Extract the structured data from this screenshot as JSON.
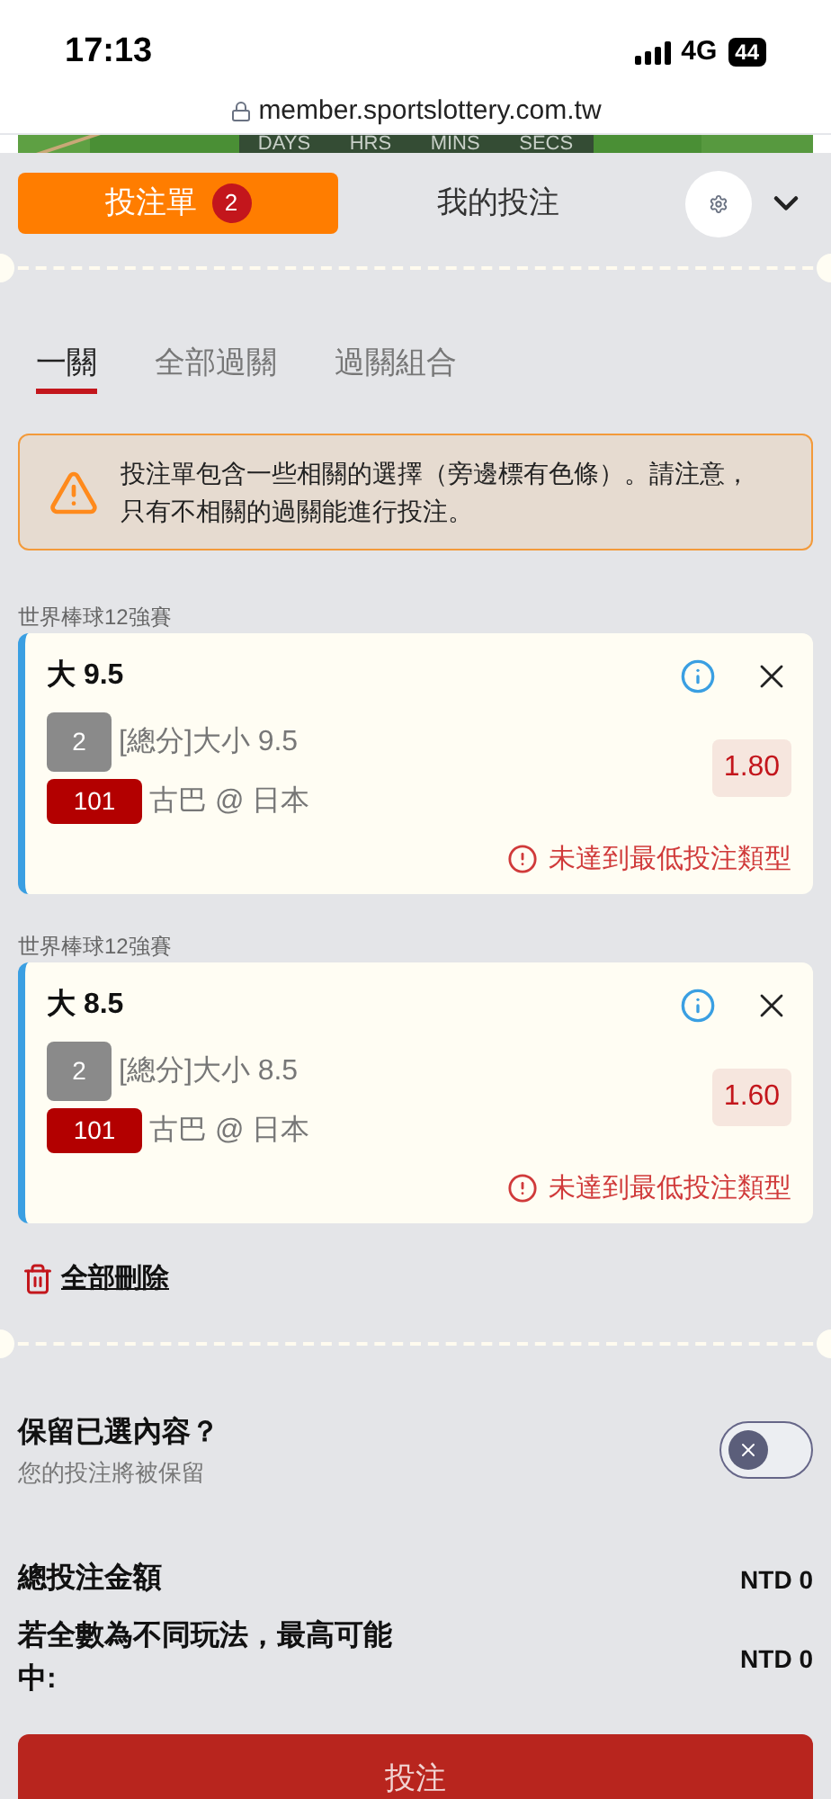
{
  "status_bar": {
    "time": "17:13",
    "network": "4G",
    "battery": "44"
  },
  "browser": {
    "url": "member.sportslottery.com.tw"
  },
  "banner": {
    "labels": [
      "DAYS",
      "HRS",
      "MINS",
      "SECS"
    ]
  },
  "header_tabs": [
    {
      "label": "投注單",
      "badge": "2",
      "selected": true
    },
    {
      "label": "我的投注",
      "selected": false
    }
  ],
  "bet_type_tabs": [
    {
      "label": "一關",
      "selected": true
    },
    {
      "label": "全部過關",
      "selected": false
    },
    {
      "label": "過關組合",
      "selected": false
    }
  ],
  "warning": "投注單包含一些相關的選擇（旁邊標有色條）。請注意，只有不相關的過關能進行投注。",
  "bets": [
    {
      "league": "世界棒球12強賽",
      "selection": "大 9.5",
      "market_code": "2",
      "market": "[總分]大小 9.5",
      "match_code": "101",
      "match": "古巴 @ 日本",
      "odds": "1.80",
      "error": "未達到最低投注類型",
      "related": true
    },
    {
      "league": "世界棒球12強賽",
      "selection": "大 8.5",
      "market_code": "2",
      "market": "[總分]大小 8.5",
      "match_code": "101",
      "match": "古巴 @ 日本",
      "odds": "1.60",
      "error": "未達到最低投注類型",
      "related": true
    }
  ],
  "delete_all": "全部刪除",
  "keep_selections": {
    "title": "保留已選內容？",
    "subtitle": "您的投注將被保留",
    "on": false
  },
  "totals": [
    {
      "label": "總投注金額",
      "value": "NTD 0"
    },
    {
      "label": "若全數為不同玩法，最高可能中:",
      "value": "NTD 0"
    }
  ],
  "submit": "投注"
}
